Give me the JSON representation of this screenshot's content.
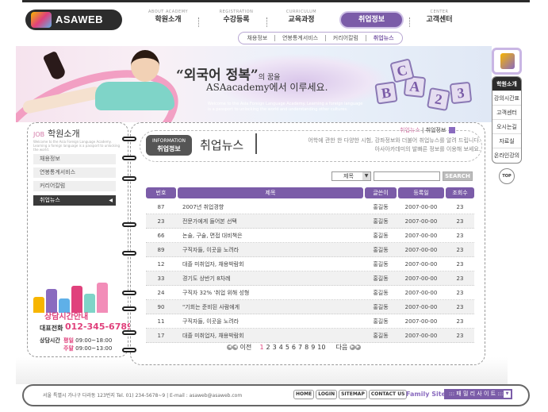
{
  "logo": {
    "text": "ASAWEB"
  },
  "gnb": [
    {
      "en": "ABOUT ACADEMY",
      "ko": "학원소개"
    },
    {
      "en": "REGISTRATION",
      "ko": "수강등록"
    },
    {
      "en": "CURRICULUM",
      "ko": "교육과정"
    },
    {
      "en": "",
      "ko": "취업정보"
    },
    {
      "en": "CENTER",
      "ko": "고객센터"
    }
  ],
  "subnav": [
    "채용정보",
    "연봉통계서비스",
    "커리어칼럼",
    "취업뉴스"
  ],
  "banner": {
    "head": "“외국어 정복”",
    "head_small": "의 꿈을",
    "sub": "ASAacademy에서 이루세요.",
    "en": "Welcome to the Asia Foreign Language Academy. Learning a foreign language is a passport to unlocking the world and understanding other cultures.",
    "blocks": [
      "B",
      "A",
      "C",
      "2",
      "3"
    ]
  },
  "quick": {
    "items": [
      "학원소개",
      "강의시간표",
      "고객센터",
      "오시는길",
      "자료실",
      "온라인강의"
    ],
    "top": "TOP"
  },
  "left": {
    "job": "JOB",
    "title": "학원소개",
    "sub": "Welcome to the Asia Foreign Language Academy. Learning a foreign language is a passport to unlocking the world.",
    "menu": [
      "채용정보",
      "연봉통계서비스",
      "커리어칼럼",
      "취업뉴스"
    ],
    "counsel_title": "상담시간안내",
    "tel_label": "대표전화",
    "tel": "012-345-6789",
    "hours_label": "상담시간",
    "hours": [
      {
        "day": "평일",
        "time": "09:00~18:00"
      },
      {
        "day": "주말",
        "time": "09:00~13:00"
      }
    ]
  },
  "content": {
    "badge_en": "INFORMATION",
    "badge_ko": "취업정보",
    "title": "취업뉴스",
    "location": {
      "current": "취업뉴스",
      "parent": "취업정보"
    },
    "intro": [
      "어학에 관한 한 다양한 시험, 강좌정보와 더불어 취업뉴스를 알려 드립니다.",
      "아사아카데미의 발빠른 정보를 이용해 보세요."
    ]
  },
  "search": {
    "select": "제목",
    "input": "",
    "button": "SEARCH"
  },
  "table": {
    "headers": [
      "번호",
      "제목",
      "글쓴이",
      "등록일",
      "조회수"
    ],
    "rows": [
      [
        "87",
        "2007년 취업경향",
        "홍길동",
        "2007-00-00",
        "23"
      ],
      [
        "23",
        "전문가에게 들어본 선택",
        "홍길동",
        "2007-00-00",
        "23"
      ],
      [
        "66",
        "논술, 구술, 면접 대비책은",
        "홍길동",
        "2007-00-00",
        "23"
      ],
      [
        "89",
        "구직자들, 이곳을 노려라",
        "홍길동",
        "2007-00-00",
        "23"
      ],
      [
        "12",
        "대졸 미취업자, 채용박람회",
        "홍길동",
        "2007-00-00",
        "23"
      ],
      [
        "33",
        "경기도 상반기 8차례",
        "홍길동",
        "2007-00-00",
        "23"
      ],
      [
        "24",
        "구직자 32% '취업 위해 성형",
        "홍길동",
        "2007-00-00",
        "23"
      ],
      [
        "90",
        "\"기회는 준비된 사람에게",
        "홍길동",
        "2007-00-00",
        "23"
      ],
      [
        "11",
        "구직자들, 이곳을 노려라",
        "홍길동",
        "2007-00-00",
        "23"
      ],
      [
        "17",
        "대졸 미취업자, 채용박람회",
        "홍길동",
        "2007-00-00",
        "23"
      ]
    ]
  },
  "paging": {
    "prev": "이전",
    "next": "다음",
    "pages": [
      "1",
      "2",
      "3",
      "4",
      "5",
      "6",
      "7",
      "8",
      "9",
      "10"
    ]
  },
  "footer": {
    "address": "서울 특별시 가나구 다라동 123번지 Tel. 01) 234-5678~9  |  E-mail : asaweb@asaweb.com",
    "links": [
      "HOME",
      "LOGIN",
      "SITEMAP",
      "CONTACT US"
    ],
    "family_label": "Family Site",
    "family_select": "::: 패 밀 리 사 이 트 :::"
  },
  "colors": {
    "accent": "#7b5ca8",
    "pink": "#e0417c",
    "dark": "#2b2b2b"
  }
}
